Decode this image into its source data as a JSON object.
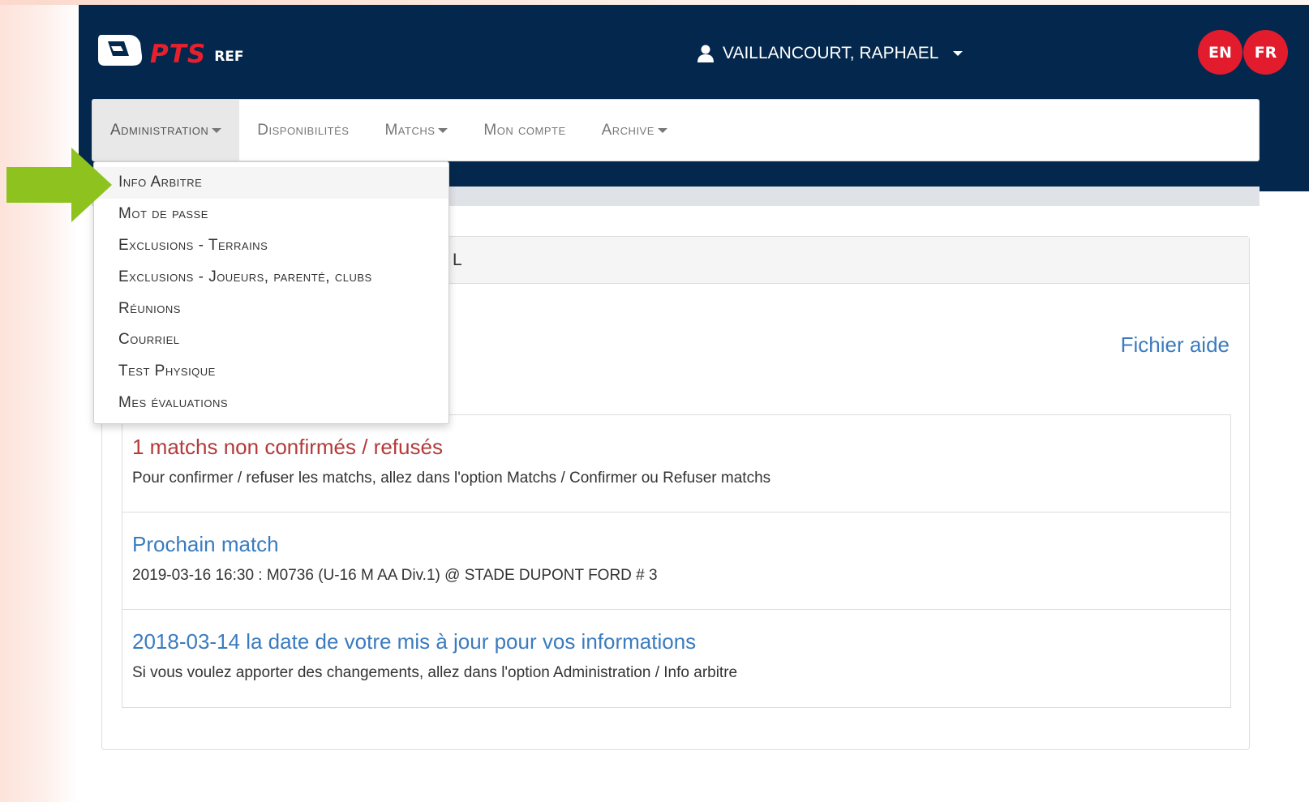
{
  "brand": {
    "logo_text": "PTS",
    "logo_sub": "REF",
    "accent": "#e8202e",
    "header_bg": "#04284d"
  },
  "user": {
    "name": "VAILLANCOURT, RAPHAEL"
  },
  "languages": [
    "EN",
    "FR"
  ],
  "nav": {
    "items": [
      {
        "label": "Administration",
        "active": true,
        "has_caret": true
      },
      {
        "label": "Disponibilités",
        "active": false,
        "has_caret": false
      },
      {
        "label": "Matchs",
        "active": false,
        "has_caret": true
      },
      {
        "label": "Mon compte",
        "active": false,
        "has_caret": false
      },
      {
        "label": "Archive",
        "active": false,
        "has_caret": true
      }
    ]
  },
  "dropdown": {
    "items": [
      "Info Arbitre",
      "Mot de passe",
      "Exclusions - Terrains",
      "Exclusions - Joueurs, parenté, clubs",
      "Réunions",
      "Courriel",
      "Test Physique",
      "Mes évaluations"
    ],
    "highlighted": "Info Arbitre"
  },
  "panel": {
    "heading_visible_fragment": "L",
    "help_link": "Fichier aide",
    "items": [
      {
        "title": "1 matchs non confirmés / refusés",
        "text": "Pour confirmer / refuser les matchs, allez dans l'option Matchs / Confirmer ou Refuser matchs",
        "tone": "danger"
      },
      {
        "title": "Prochain match",
        "text": "2019-03-16 16:30 : M0736 (U-16 M AA Div.1) @ STADE DUPONT FORD # 3",
        "tone": "info"
      },
      {
        "title": "2018-03-14 la date de votre mis à jour pour vos informations",
        "text": "Si vous voulez apporter des changements, allez dans l'option Administration / Info arbitre",
        "tone": "info"
      }
    ]
  },
  "annotation": {
    "arrow_color": "#8dc21f",
    "icon": "arrow-right-icon"
  }
}
